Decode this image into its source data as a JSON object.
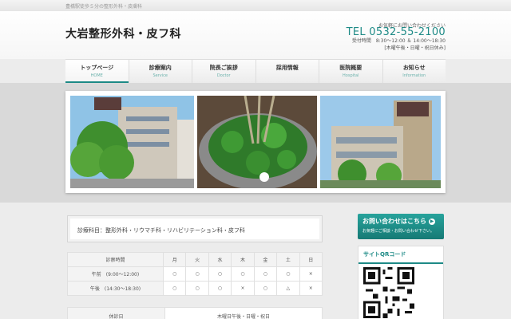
{
  "header": {
    "tagline": "豊橋駅徒歩５分の整形外科・皮膚科",
    "site_title": "大岩整形外科・皮フ科",
    "contact_note": "お気軽にお問い合わせください",
    "tel": "TEL 0532-55-2100",
    "hours_line1": "受付時間　8:30〜12:00 ＆ 14:00〜18:30",
    "hours_line2": "[木曜午後・日曜・祝日休み]"
  },
  "nav": {
    "items": [
      {
        "jp": "トップページ",
        "en": "HOME"
      },
      {
        "jp": "診療案内",
        "en": "Service"
      },
      {
        "jp": "院長ご挨拶",
        "en": "Doctor"
      },
      {
        "jp": "採用情報",
        "en": ""
      },
      {
        "jp": "医院概要",
        "en": "Hospital"
      },
      {
        "jp": "お知らせ",
        "en": "Information"
      }
    ]
  },
  "main": {
    "subjects": "診療科目：整形外科・リウマチ科・リハビリテーション科・皮フ科",
    "hours_table": {
      "header": [
        "診察時間",
        "月",
        "火",
        "水",
        "木",
        "金",
        "土",
        "日"
      ],
      "rows": [
        [
          "午前　(9:00〜12:00)",
          "○",
          "○",
          "○",
          "○",
          "○",
          "○",
          "×"
        ],
        [
          "午後　(14:30〜18:30)",
          "○",
          "○",
          "○",
          "×",
          "○",
          "△",
          "×"
        ]
      ]
    },
    "closed_label": "休診日",
    "closed_value": "木曜日午後・日曜・祝日"
  },
  "sidebar": {
    "contact_title": "お問い合わせはこちら",
    "contact_sub": "お気軽にご相談・お問い合わせ下さい。",
    "qr_title": "サイトQRコード"
  },
  "colors": {
    "accent": "#1d8a86",
    "nav_en": "#6ab1ab",
    "band": "#d9d9d9"
  }
}
